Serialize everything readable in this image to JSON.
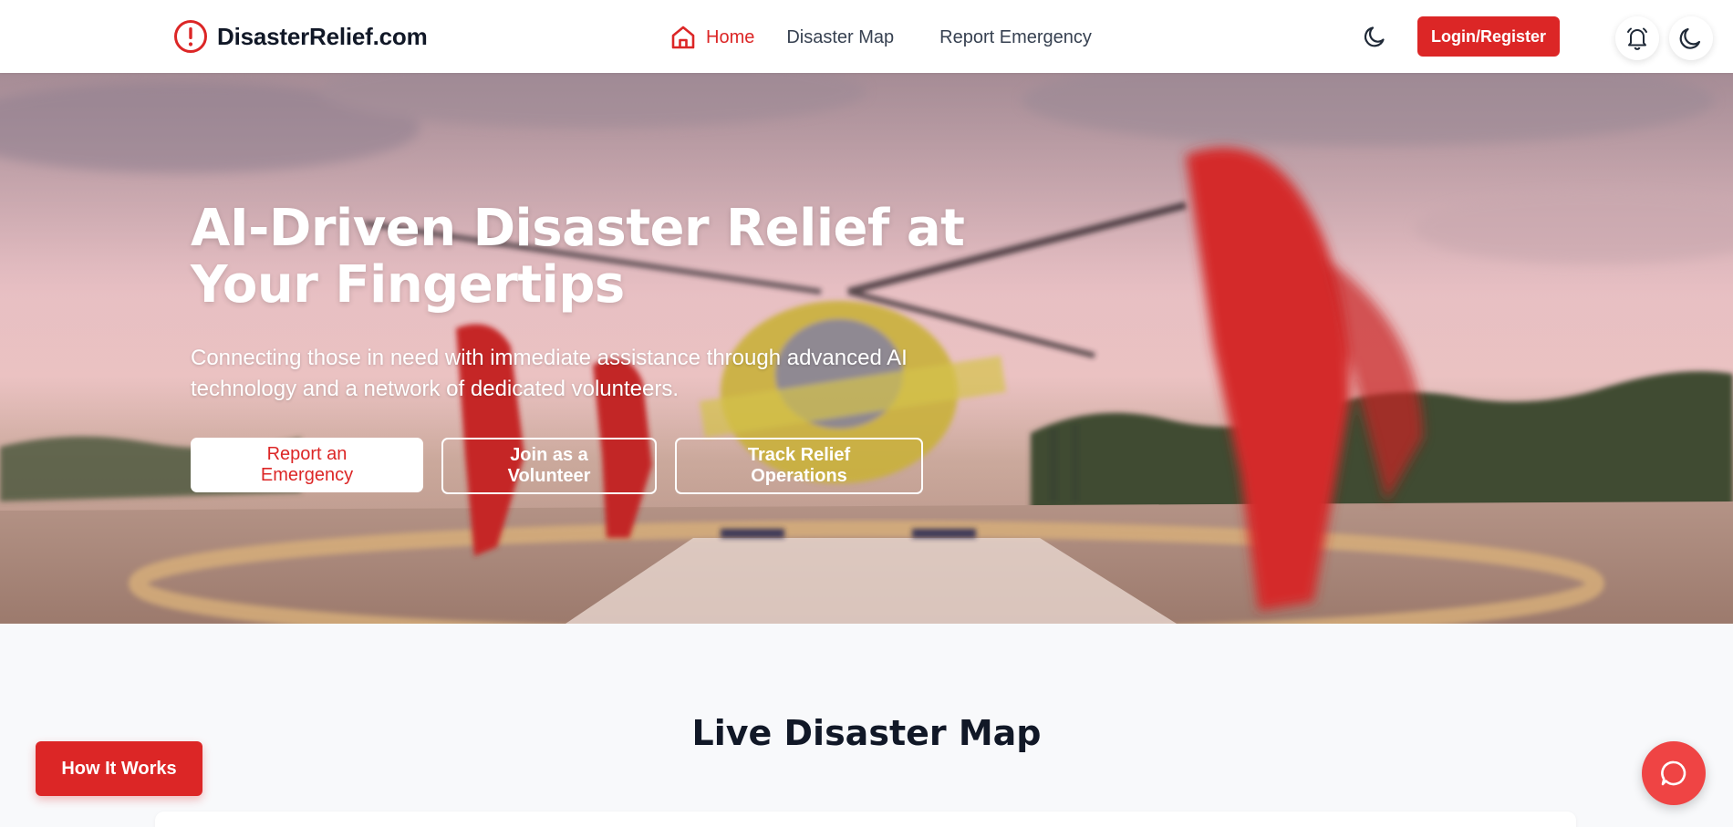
{
  "brand": {
    "name": "DisasterRelief.com",
    "icon": "alert-circle-icon"
  },
  "nav": {
    "home": "Home",
    "map": "Disaster Map",
    "report": "Report Emergency"
  },
  "header": {
    "login_label": "Login/Register",
    "theme_icon": "moon-icon",
    "notification_icon": "bell-icon"
  },
  "hero": {
    "title_line1": "AI-Driven Disaster Relief at",
    "title_line2": "Your Fingertips",
    "subtitle": "Connecting those in need with immediate assistance through advanced AI technology and a network of dedicated volunteers.",
    "buttons": {
      "report": "Report an Emergency",
      "volunteer": "Join as a Volunteer",
      "track": "Track Relief Operations"
    }
  },
  "map_section": {
    "title": "Live Disaster Map"
  },
  "floating": {
    "how_it_works": "How It Works",
    "chat_icon": "chat-bubble-icon"
  },
  "colors": {
    "accent": "#dc2626",
    "chat": "#ef4444",
    "background": "#f8f9fb"
  }
}
